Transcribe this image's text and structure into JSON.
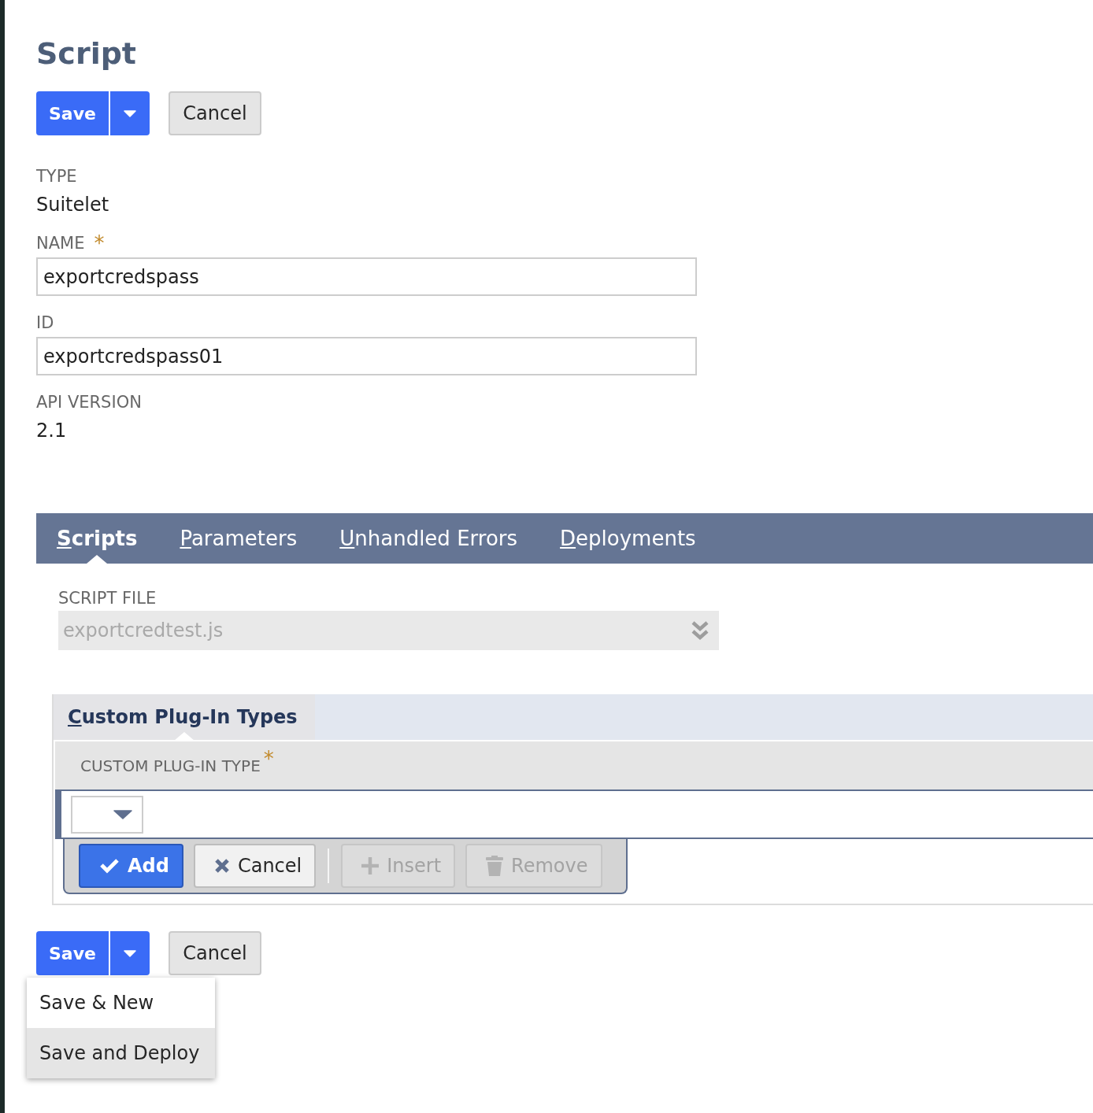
{
  "page": {
    "title": "Script"
  },
  "top_actions": {
    "save": "Save",
    "cancel": "Cancel"
  },
  "fields": [
    {
      "kind": "readonly",
      "label": "TYPE",
      "value": "Suitelet"
    },
    {
      "kind": "text",
      "label": "NAME",
      "required_mark": "*",
      "value": "exportcredspass"
    },
    {
      "kind": "text",
      "label": "ID",
      "value": "exportcredspass01"
    },
    {
      "kind": "readonly",
      "label": "API VERSION",
      "value": "2.1"
    }
  ],
  "tabs": [
    {
      "label": "Scripts",
      "selected": true
    },
    {
      "label": "Parameters",
      "selected": false
    },
    {
      "label": "Unhandled Errors",
      "selected": false
    },
    {
      "label": "Deployments",
      "selected": false
    }
  ],
  "script_file": {
    "label": "SCRIPT FILE",
    "value": "exportcredtest.js",
    "disabled": true
  },
  "sublist": {
    "tabs": [
      {
        "label": "Custom Plug-In Types",
        "selected": true
      }
    ],
    "columns": [
      {
        "label": "CUSTOM PLUG-IN TYPE",
        "required_mark": "*"
      }
    ],
    "buttons": [
      {
        "kind": "add",
        "label": "Add",
        "disabled": false
      },
      {
        "kind": "cancel",
        "label": "Cancel",
        "disabled": false
      },
      {
        "kind": "insert",
        "label": "Insert",
        "disabled": true
      },
      {
        "kind": "remove",
        "label": "Remove",
        "disabled": true
      }
    ]
  },
  "bottom_actions": {
    "save": "Save",
    "cancel": "Cancel",
    "menu": [
      {
        "label": "Save & New",
        "selected": false
      },
      {
        "label": "Save and Deploy",
        "selected": true
      }
    ]
  }
}
